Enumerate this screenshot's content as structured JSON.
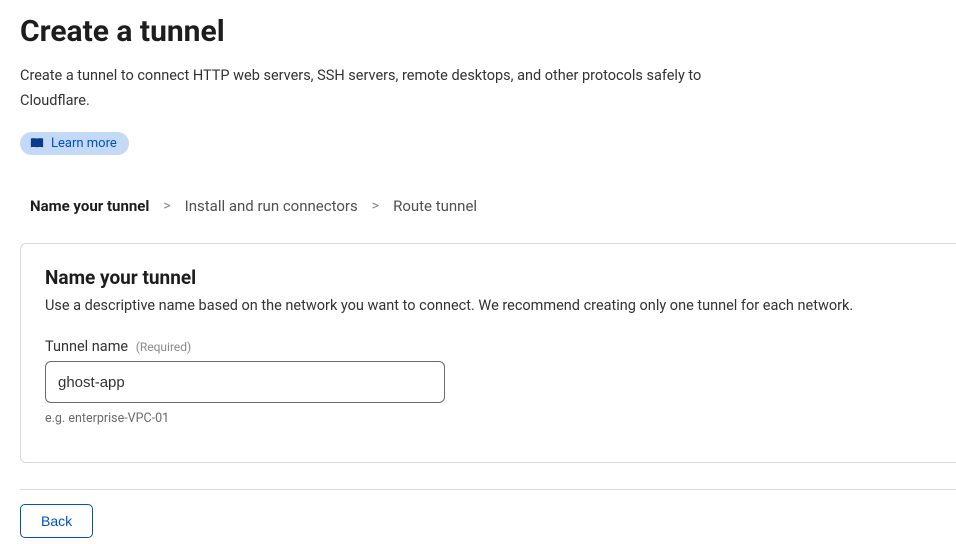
{
  "page": {
    "title": "Create a tunnel",
    "subtitle": "Create a tunnel to connect HTTP web servers, SSH servers, remote desktops, and other protocols safely to Cloudflare.",
    "learn_more_label": "Learn more"
  },
  "steps": {
    "items": [
      {
        "label": "Name your tunnel",
        "active": true
      },
      {
        "label": "Install and run connectors",
        "active": false
      },
      {
        "label": "Route tunnel",
        "active": false
      }
    ],
    "separator": ">"
  },
  "panel": {
    "heading": "Name your tunnel",
    "description": "Use a descriptive name based on the network you want to connect. We recommend creating only one tunnel for each network.",
    "field": {
      "label": "Tunnel name",
      "required_tag": "(Required)",
      "value": "ghost-app",
      "hint": "e.g. enterprise-VPC-01"
    }
  },
  "footer": {
    "back_label": "Back"
  }
}
